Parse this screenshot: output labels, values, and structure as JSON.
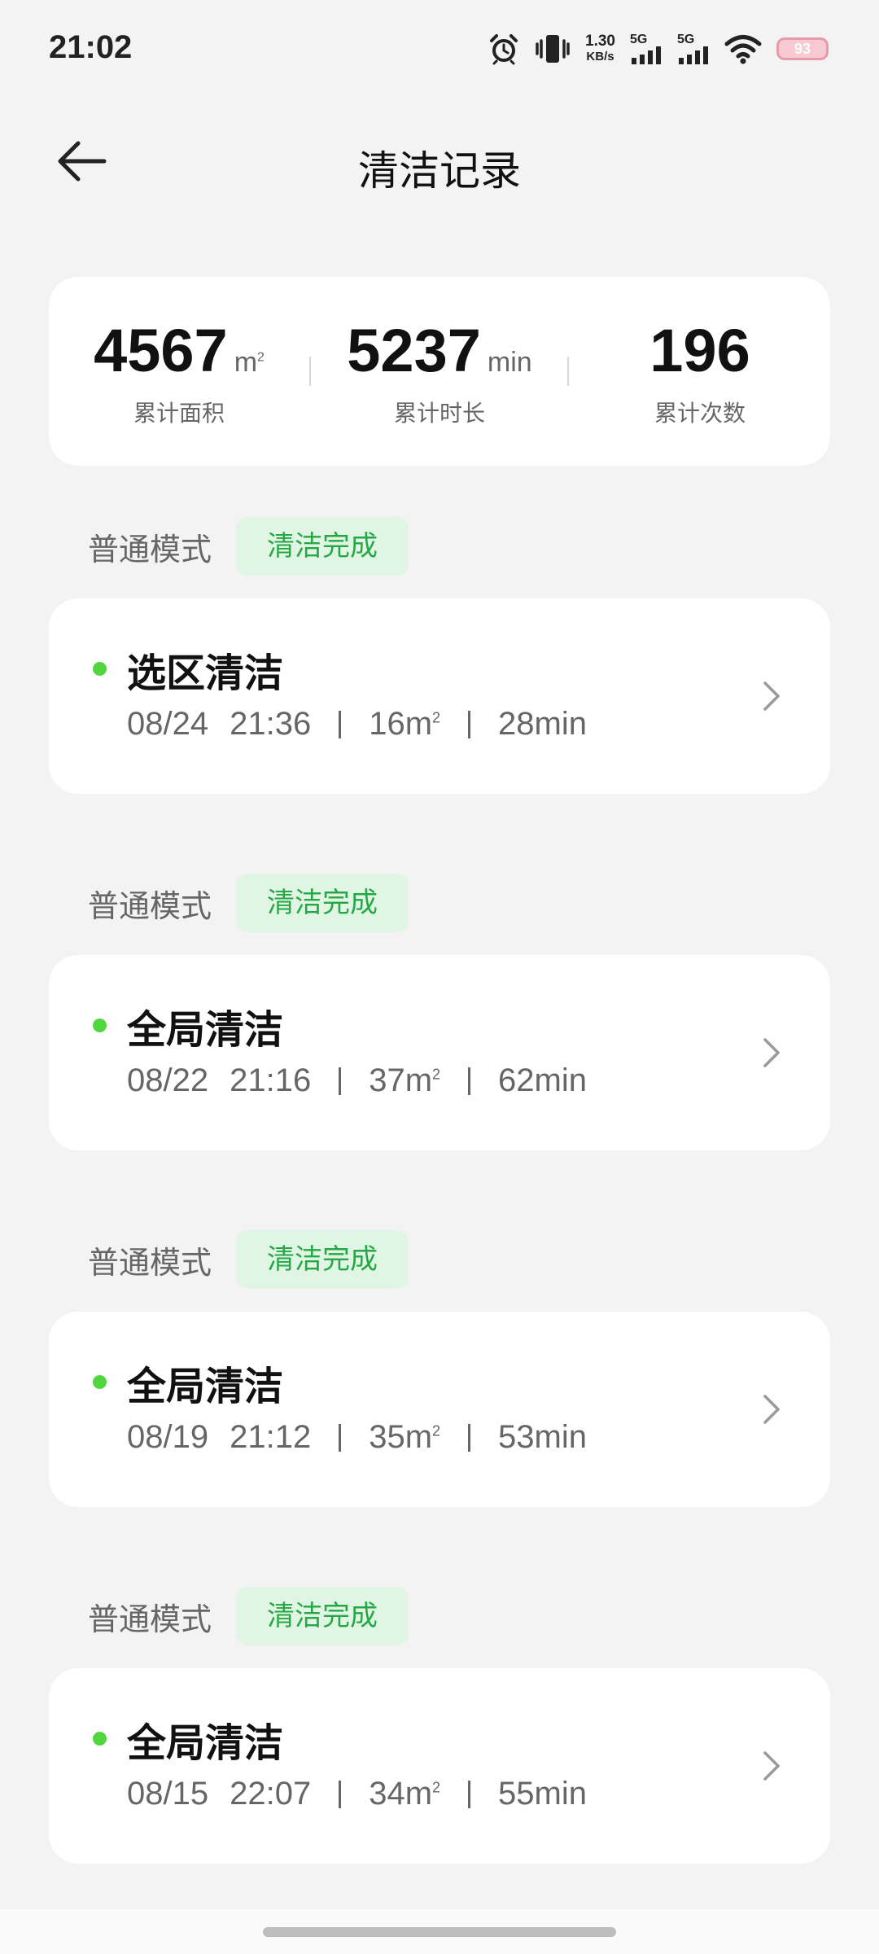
{
  "status_bar": {
    "time": "21:02",
    "net_speed_value": "1.30",
    "net_speed_unit": "KB/s",
    "sim1_label": "5G",
    "sim2_label": "5G",
    "battery": "93",
    "icons": [
      "alarm-icon",
      "vibrate-icon",
      "signal-icon",
      "signal-icon",
      "wifi-icon",
      "battery-icon"
    ]
  },
  "header": {
    "title": "清洁记录",
    "back_icon": "arrow-left-icon"
  },
  "summary": {
    "area_value": "4567",
    "area_unit": "m",
    "area_unit_sup": "2",
    "area_label": "累计面积",
    "duration_value": "5237",
    "duration_unit": "min",
    "duration_label": "累计时长",
    "count_value": "196",
    "count_label": "累计次数"
  },
  "records": [
    {
      "mode": "普通模式",
      "status": "清洁完成",
      "title": "选区清洁",
      "date": "08/24",
      "time": "21:36",
      "area": "16m",
      "area_sup": "2",
      "duration": "28min"
    },
    {
      "mode": "普通模式",
      "status": "清洁完成",
      "title": "全局清洁",
      "date": "08/22",
      "time": "21:16",
      "area": "37m",
      "area_sup": "2",
      "duration": "62min"
    },
    {
      "mode": "普通模式",
      "status": "清洁完成",
      "title": "全局清洁",
      "date": "08/19",
      "time": "21:12",
      "area": "35m",
      "area_sup": "2",
      "duration": "53min"
    },
    {
      "mode": "普通模式",
      "status": "清洁完成",
      "title": "全局清洁",
      "date": "08/15",
      "time": "22:07",
      "area": "34m",
      "area_sup": "2",
      "duration": "55min"
    }
  ],
  "colors": {
    "accent_green": "#27a846",
    "badge_bg": "#e1f5e4",
    "dot_green": "#52d63f",
    "page_bg": "#f3f3f3"
  }
}
